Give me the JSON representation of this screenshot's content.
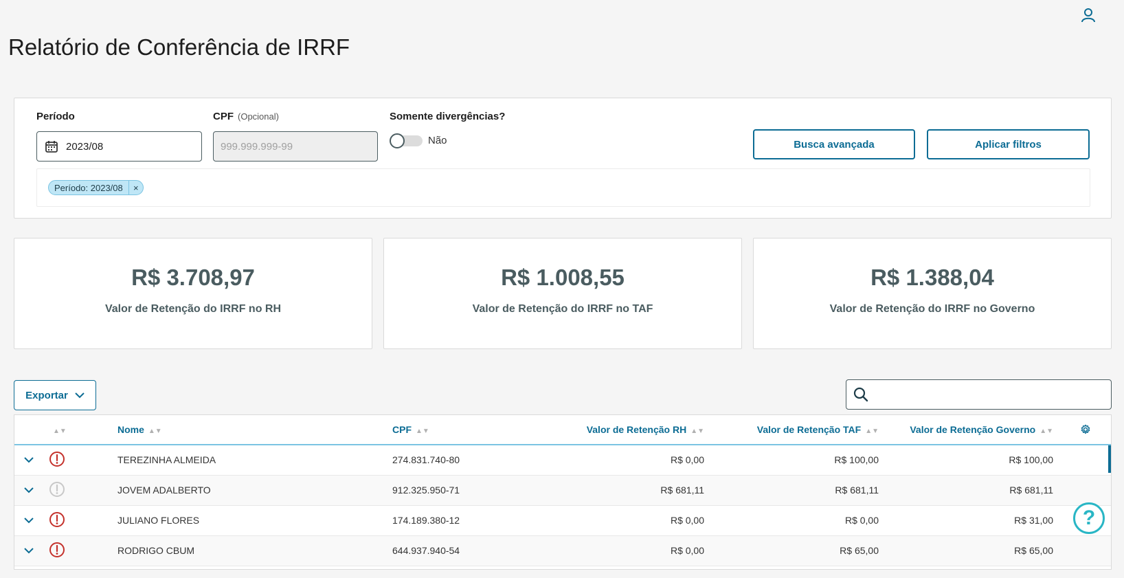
{
  "page": {
    "title": "Relatório de Conferência de IRRF"
  },
  "filters": {
    "period_label": "Período",
    "period_value": "2023/08",
    "cpf_label": "CPF",
    "cpf_optional": "(Opcional)",
    "cpf_placeholder": "999.999.999-99",
    "divergence_label": "Somente divergências?",
    "divergence_value": "Não",
    "advanced_search": "Busca avançada",
    "apply": "Aplicar filtros",
    "tag_label": "Período: 2023/08",
    "tag_close": "×"
  },
  "cards": [
    {
      "amount": "R$ 3.708,97",
      "label": "Valor de Retenção do IRRF no RH"
    },
    {
      "amount": "R$ 1.008,55",
      "label": "Valor de Retenção do IRRF no TAF"
    },
    {
      "amount": "R$ 1.388,04",
      "label": "Valor de Retenção do IRRF no Governo"
    }
  ],
  "toolbar": {
    "export": "Exportar"
  },
  "table": {
    "columns": {
      "nome": "Nome",
      "cpf": "CPF",
      "rh": "Valor de Retenção RH",
      "taf": "Valor de Retenção TAF",
      "gov": "Valor de Retenção Governo"
    },
    "rows": [
      {
        "nome": "TEREZINHA ALMEIDA",
        "cpf": "274.831.740-80",
        "rh": "R$ 0,00",
        "taf": "R$ 100,00",
        "gov": "R$ 100,00",
        "status": "divergent"
      },
      {
        "nome": "JOVEM ADALBERTO",
        "cpf": "912.325.950-71",
        "rh": "R$ 681,11",
        "taf": "R$ 681,11",
        "gov": "R$ 681,11",
        "status": "ok"
      },
      {
        "nome": "JULIANO FLORES",
        "cpf": "174.189.380-12",
        "rh": "R$ 0,00",
        "taf": "R$ 0,00",
        "gov": "R$ 31,00",
        "status": "divergent"
      },
      {
        "nome": "RODRIGO CBUM",
        "cpf": "644.937.940-54",
        "rh": "R$ 0,00",
        "taf": "R$ 65,00",
        "gov": "R$ 65,00",
        "status": "divergent"
      }
    ]
  },
  "help": {
    "label": "?"
  },
  "colors": {
    "primary": "#0c6c94",
    "error": "#c4312b",
    "disabled_icon": "#c8c8c8",
    "help": "#29b6c5"
  }
}
